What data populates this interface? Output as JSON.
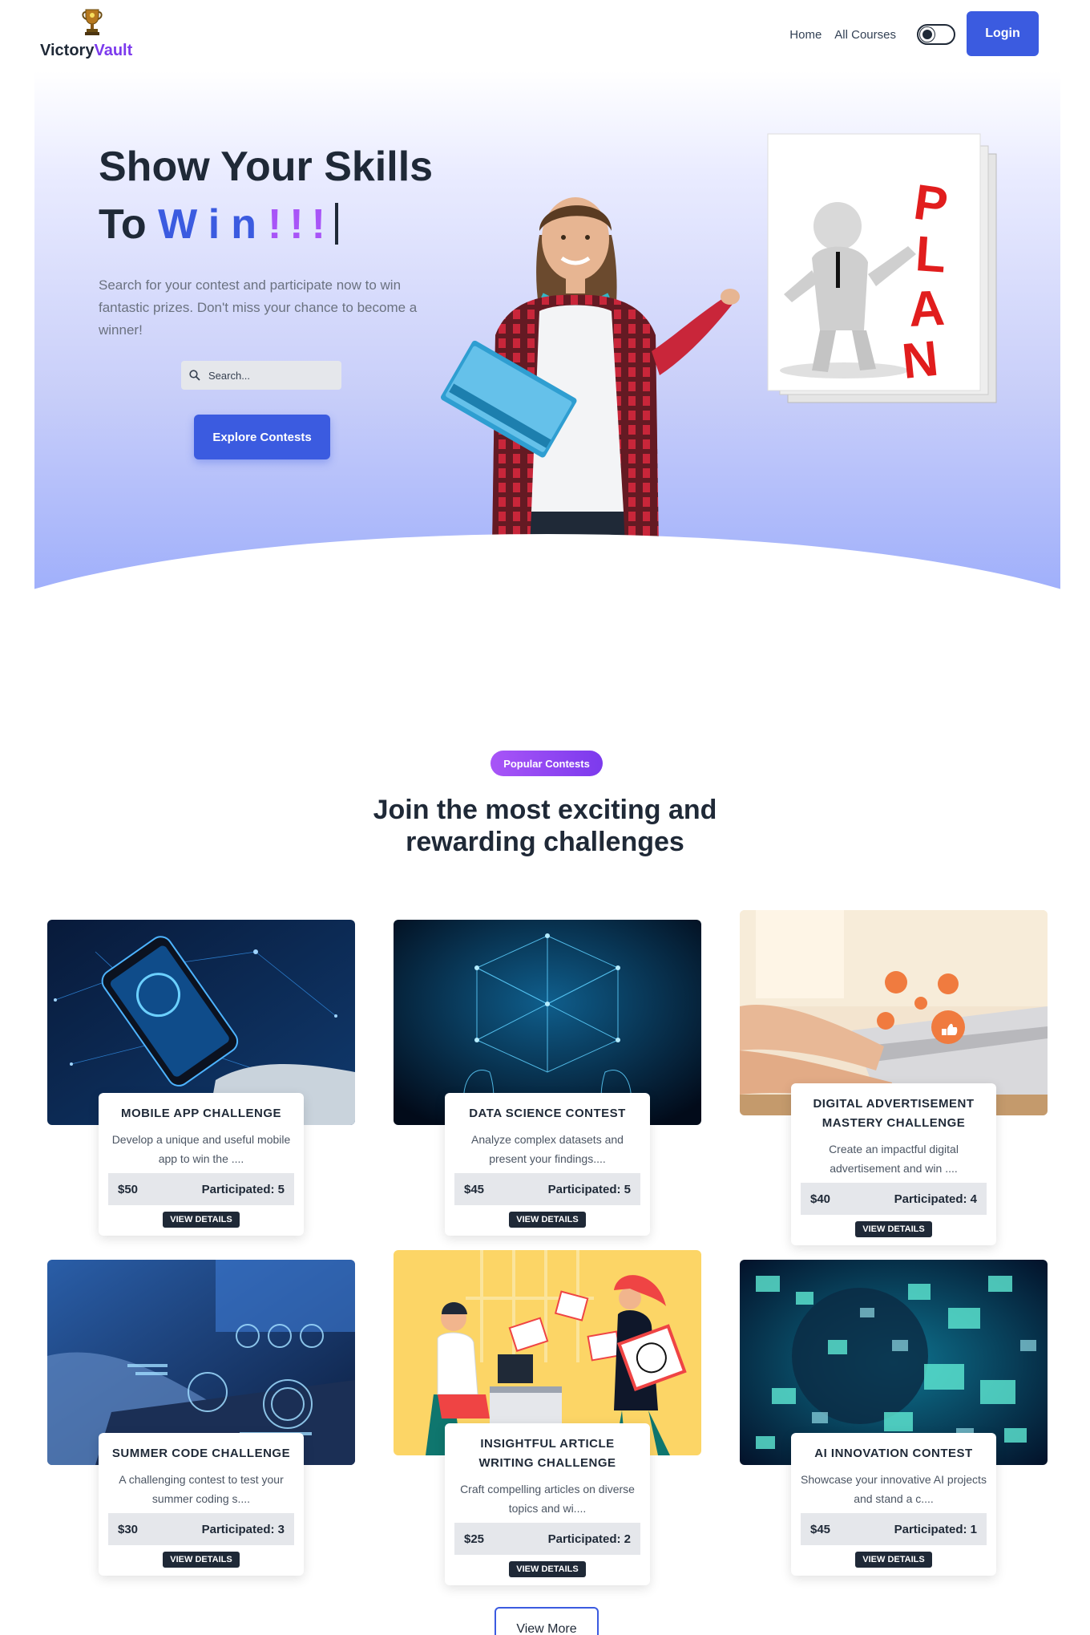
{
  "brand": {
    "name_part1": "Victory",
    "name_part2": "Vault"
  },
  "nav": {
    "home": "Home",
    "all_courses": "All Courses",
    "login": "Login"
  },
  "hero": {
    "title_line1": "Show Your Skills",
    "title_line2_prefix": "To",
    "title_line2_win": "Win",
    "title_line2_bang": "!!!",
    "description": "Search for your contest and participate now to win fantastic prizes. Don't miss your chance to become a winner!",
    "search_placeholder": "Search...",
    "cta": "Explore Contests",
    "plan_word": "PLAN"
  },
  "section": {
    "pill": "Popular Contests",
    "title": "Join the most exciting and rewarding challenges"
  },
  "contests": [
    {
      "title": "MOBILE APP CHALLENGE",
      "desc": "Develop a unique and useful mobile app to win the ....",
      "prize": "$50",
      "participated": "Participated: 5",
      "button": "VIEW DETAILS"
    },
    {
      "title": "DATA SCIENCE CONTEST",
      "desc": "Analyze complex datasets and present your findings....",
      "prize": "$45",
      "participated": "Participated: 5",
      "button": "VIEW DETAILS"
    },
    {
      "title": "DIGITAL ADVERTISEMENT MASTERY CHALLENGE",
      "desc": "Create an impactful digital advertisement and win ....",
      "prize": "$40",
      "participated": "Participated: 4",
      "button": "VIEW DETAILS"
    },
    {
      "title": "SUMMER CODE CHALLENGE",
      "desc": "A challenging contest to test your summer coding s....",
      "prize": "$30",
      "participated": "Participated: 3",
      "button": "VIEW DETAILS"
    },
    {
      "title": "INSIGHTFUL ARTICLE WRITING CHALLENGE",
      "desc": "Craft compelling articles on diverse topics and wi....",
      "prize": "$25",
      "participated": "Participated: 2",
      "button": "VIEW DETAILS"
    },
    {
      "title": "AI INNOVATION CONTEST",
      "desc": "Showcase your innovative AI projects and stand a c....",
      "prize": "$45",
      "participated": "Participated: 1",
      "button": "VIEW DETAILS"
    }
  ],
  "view_more": "View More",
  "colors": {
    "primary": "#3b5be0",
    "accent_purple": "#a855f7",
    "dark": "#1f2937"
  }
}
